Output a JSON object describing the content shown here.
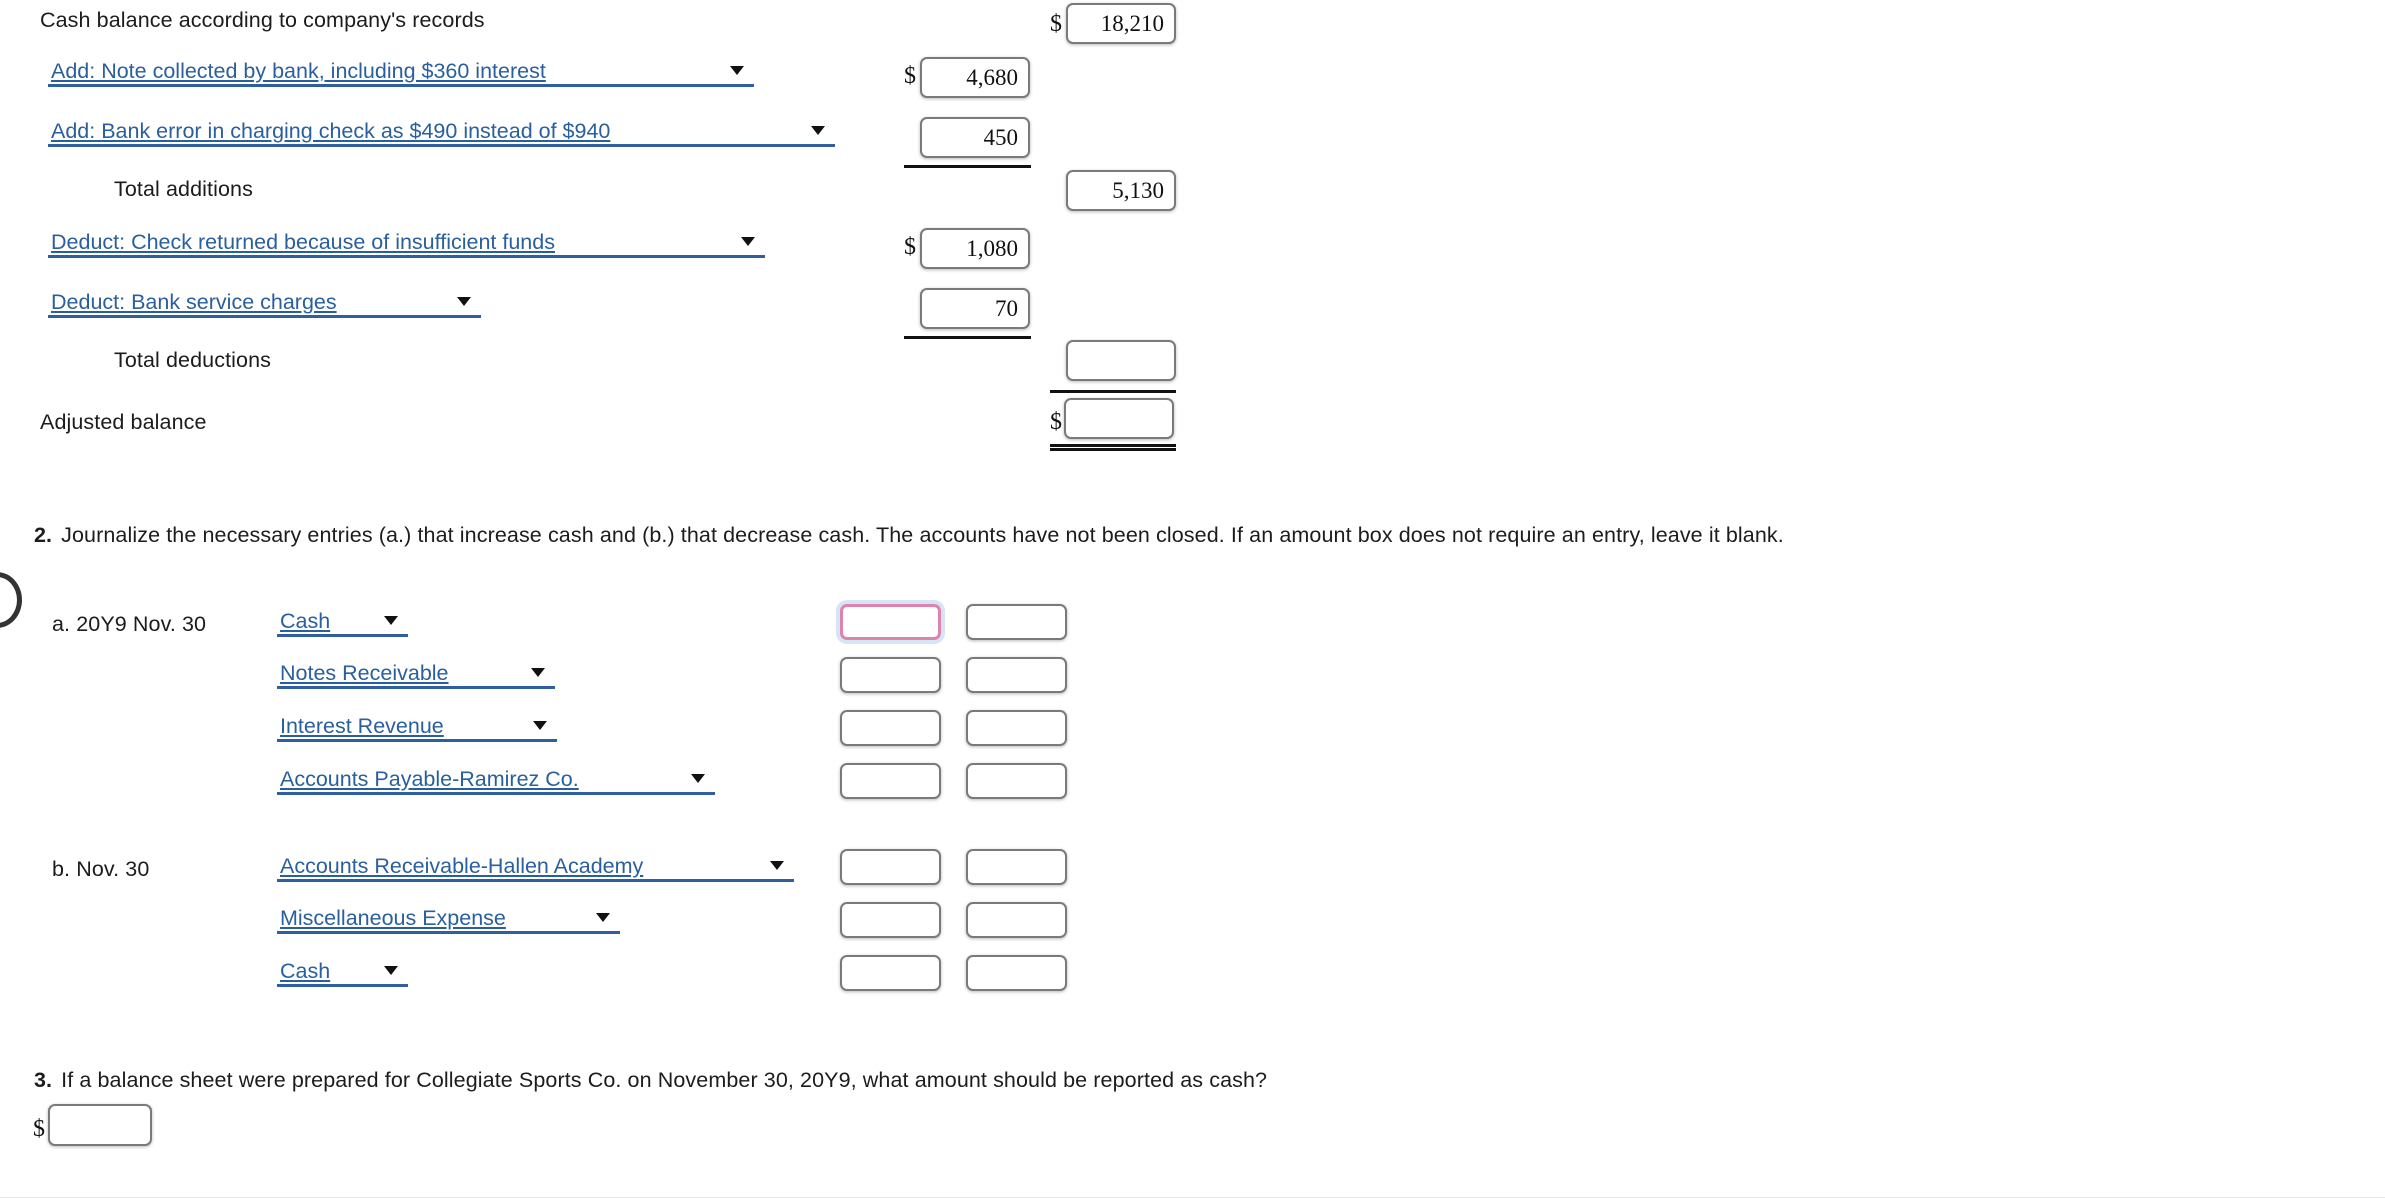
{
  "reconciliation": {
    "opening_label": "Cash balance according to company's records",
    "opening_dollar": "$",
    "opening_value": "18,210",
    "additions": [
      {
        "select_label": "Add: Note collected by bank, including $360 interest",
        "dollar": "$",
        "value": "4,680"
      },
      {
        "select_label": "Add: Bank error in charging check as $490 instead of $940",
        "dollar": "",
        "value": "450"
      }
    ],
    "total_additions_label": "Total additions",
    "total_additions_value": "5,130",
    "deductions": [
      {
        "select_label": "Deduct: Check returned because of insufficient funds",
        "dollar": "$",
        "value": "1,080"
      },
      {
        "select_label": "Deduct: Bank service charges",
        "dollar": "",
        "value": "70"
      }
    ],
    "total_deductions_label": "Total deductions",
    "total_deductions_value": "",
    "adjusted_balance_label": "Adjusted balance",
    "adjusted_balance_dollar": "$",
    "adjusted_balance_value": ""
  },
  "question2": {
    "number": "2.",
    "text": "Journalize the necessary entries (a.) that increase cash and (b.) that decrease cash. The accounts have not been closed. If an amount box does not require an entry, leave it blank.",
    "entries": [
      {
        "id": "a",
        "date_label": "a. 20Y9 Nov. 30",
        "lines": [
          {
            "account": "Cash",
            "debit": "",
            "credit": "",
            "focused": true
          },
          {
            "account": "Notes Receivable",
            "debit": "",
            "credit": "",
            "focused": false
          },
          {
            "account": "Interest Revenue",
            "debit": "",
            "credit": "",
            "focused": false
          },
          {
            "account": "Accounts Payable-Ramirez Co.",
            "debit": "",
            "credit": "",
            "focused": false
          }
        ]
      },
      {
        "id": "b",
        "date_label": "b. Nov. 30",
        "lines": [
          {
            "account": "Accounts Receivable-Hallen Academy",
            "debit": "",
            "credit": "",
            "focused": false
          },
          {
            "account": "Miscellaneous Expense",
            "debit": "",
            "credit": "",
            "focused": false
          },
          {
            "account": "Cash",
            "debit": "",
            "credit": "",
            "focused": false
          }
        ]
      }
    ]
  },
  "question3": {
    "number": "3.",
    "text": "If a balance sheet were prepared for Collegiate Sports Co. on November 30, 20Y9, what amount should be reported as cash?",
    "dollar": "$",
    "value": ""
  },
  "colors": {
    "select_text": "#2a5f9e",
    "select_underline": "#2f5f9e",
    "box_border": "#7a7a7a",
    "focus_border": "#e083ab",
    "focus_glow": "#b2cef0",
    "rule": "#111111"
  }
}
